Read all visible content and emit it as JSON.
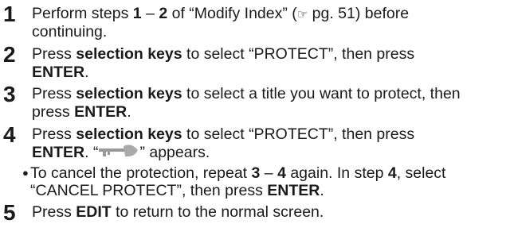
{
  "step1": {
    "number": "1",
    "line1_pre": "Perform steps ",
    "line1_b1": "1",
    "line1_mid": " – ",
    "line1_b2": "2",
    "line1_post": " of “Modify Index” (",
    "ref_icon": "☞",
    "line1_end": " pg. 51) before",
    "line2": "continuing."
  },
  "step2": {
    "number": "2",
    "line1_pre": "Press ",
    "line1_b": "selection keys",
    "line1_post": " to select “PROTECT”, then press",
    "line2_b": "ENTER",
    "line2_post": "."
  },
  "step3": {
    "number": "3",
    "line1_pre": "Press ",
    "line1_b": "selection keys",
    "line1_post": " to select a title you want to protect, then",
    "line2_pre": "press ",
    "line2_b": "ENTER",
    "line2_post": "."
  },
  "step4": {
    "number": "4",
    "line1_pre": "Press ",
    "line1_b": "selection keys",
    "line1_post": " to select “PROTECT”, then press",
    "line2_b": "ENTER",
    "line2_mid": ". “",
    "line2_post": "” appears.",
    "icon": "key-icon",
    "note_bullet": "●",
    "note_line1_pre": "To cancel the protection, repeat ",
    "note_b1": "3",
    "note_mid": " – ",
    "note_b2": "4",
    "note_line1_mid2": " again. In step ",
    "note_b3": "4",
    "note_line1_post": ", select",
    "note_line2_pre": "“CANCEL PROTECT”, then press ",
    "note_line2_b": "ENTER",
    "note_line2_post": "."
  },
  "step5": {
    "number": "5",
    "line1_pre": "Press ",
    "line1_b": "EDIT",
    "line1_post": " to return to the normal screen."
  }
}
